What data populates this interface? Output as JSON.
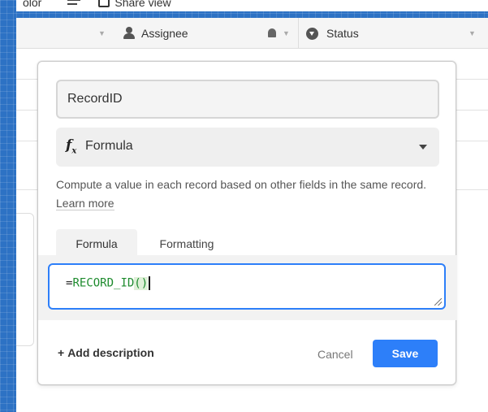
{
  "toolbar": {
    "color_label": "olor",
    "share_view_label": "Share view"
  },
  "grid": {
    "columns": [
      {
        "label": "Assignee"
      },
      {
        "label": "Status"
      }
    ]
  },
  "field_editor": {
    "field_name": "RecordID",
    "type_label": "Formula",
    "description": "Compute a value in each record based on other fields in the same record.",
    "learn_more": "Learn more",
    "tabs": [
      "Formula",
      "Formatting"
    ],
    "formula_prefix": "=",
    "formula_function": "RECORD_ID",
    "formula_parens": "()",
    "add_description": "Add description",
    "cancel_label": "Cancel",
    "save_label": "Save"
  },
  "colors": {
    "accent": "#2d7ff9",
    "formula_green": "#1e8b2e",
    "background_blue": "#2d72c4"
  }
}
